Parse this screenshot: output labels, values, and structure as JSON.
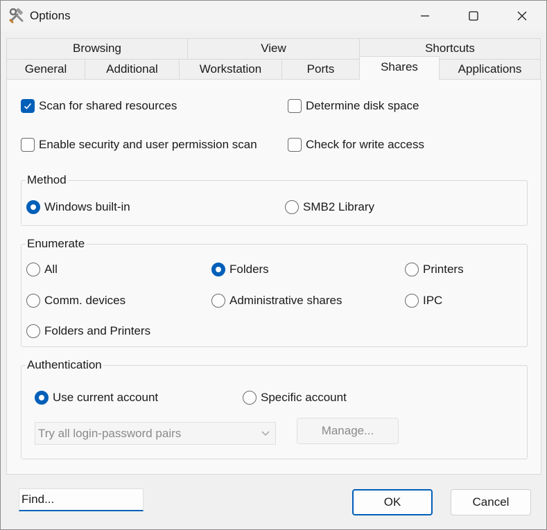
{
  "window": {
    "title": "Options"
  },
  "tabs": {
    "row1": [
      "Browsing",
      "View",
      "Shortcuts"
    ],
    "row2": [
      "General",
      "Additional",
      "Workstation",
      "Ports",
      "Shares",
      "Applications"
    ],
    "active": "Shares"
  },
  "options": {
    "scan_shared": {
      "label": "Scan for shared resources",
      "checked": true
    },
    "disk_space": {
      "label": "Determine disk space",
      "checked": false
    },
    "security_scan": {
      "label": "Enable security and user permission scan",
      "checked": false
    },
    "write_access": {
      "label": "Check for write access",
      "checked": false
    }
  },
  "method": {
    "legend": "Method",
    "windows_builtin": "Windows built-in",
    "smb2": "SMB2 Library",
    "selected": "Windows built-in"
  },
  "enumerate": {
    "legend": "Enumerate",
    "all": "All",
    "folders": "Folders",
    "printers": "Printers",
    "comm_devices": "Comm. devices",
    "admin_shares": "Administrative shares",
    "ipc": "IPC",
    "folders_printers": "Folders and Printers",
    "selected": "Folders"
  },
  "auth": {
    "legend": "Authentication",
    "current": "Use current account",
    "specific": "Specific account",
    "selected": "Use current account",
    "combo_value": "Try all login-password pairs",
    "manage": "Manage..."
  },
  "footer": {
    "find_placeholder": "Find...",
    "ok": "OK",
    "cancel": "Cancel"
  },
  "colors": {
    "accent": "#005fb8"
  }
}
